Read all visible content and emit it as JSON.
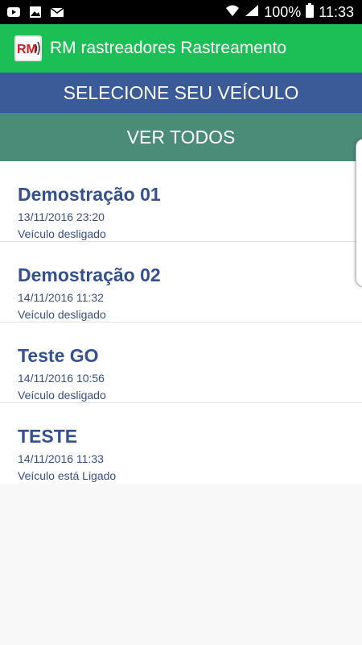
{
  "status_bar": {
    "battery": "100%",
    "time": "11:33",
    "left_icons": [
      "youtube-icon",
      "gallery-icon",
      "mail-icon"
    ],
    "right_icons": [
      "wifi-icon",
      "signal-icon",
      "battery-icon"
    ]
  },
  "app_bar": {
    "logo_text": "RM",
    "title": "RM rastreadores Rastreamento",
    "color": "#1cbf55"
  },
  "header": {
    "select_label": "SELECIONE SEU VEÍCULO",
    "select_color": "#3b5a98",
    "view_all_label": "VER TODOS",
    "view_all_color": "#4a8c78"
  },
  "vehicles": [
    {
      "name": "Demostração 01",
      "date": "13/11/2016 23:20",
      "status": "Veículo desligado"
    },
    {
      "name": "Demostração 02",
      "date": "14/11/2016 11:32",
      "status": "Veículo desligado"
    },
    {
      "name": "Teste GO",
      "date": "14/11/2016 10:56",
      "status": "Veículo desligado"
    },
    {
      "name": "TESTE",
      "date": "14/11/2016 11:33",
      "status": "Veículo está Ligado"
    }
  ]
}
